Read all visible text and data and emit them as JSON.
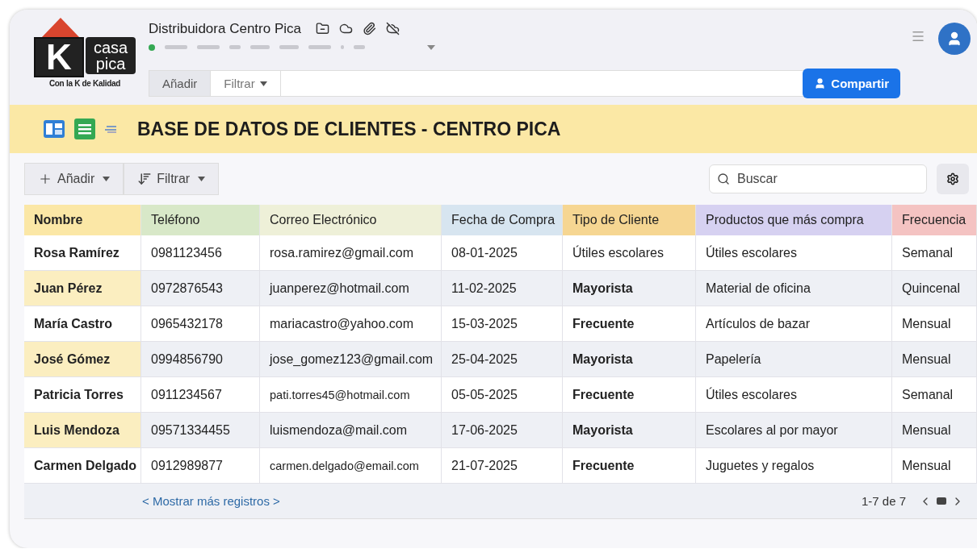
{
  "logo": {
    "letter": "K",
    "line_1": "casa",
    "line_2": "pica",
    "tagline": "Con la K de Kalidad"
  },
  "window": {
    "title": "Distribuidora Centro Pica"
  },
  "tabs": [
    {
      "label": "Añadir",
      "selected": true
    },
    {
      "label": "Filtrar",
      "selected": false,
      "dropdown": true
    }
  ],
  "share_button": "Compartir",
  "banner": {
    "title": "BASE DE DATOS DE CLIENTES - CENTRO PICA"
  },
  "toolbar": {
    "buttons": [
      {
        "label": "Añadir",
        "kind": "add"
      },
      {
        "label": "Filtrar",
        "kind": "sort"
      }
    ],
    "search": {
      "placeholder": "Buscar"
    }
  },
  "table": {
    "columns": [
      {
        "label": "Nombre",
        "color": "#fbe7a6"
      },
      {
        "label": "Teléfono",
        "color": "#d8e8c8"
      },
      {
        "label": "Correo Electrónico",
        "color": "#eef0d8"
      },
      {
        "label": "Fecha de Compra",
        "color": "#d7e5f0"
      },
      {
        "label": "Tipo de Cliente",
        "color": "#f6d692"
      },
      {
        "label": "Productos que más compra",
        "color": "#d6d1f1"
      },
      {
        "label": "Frecuencia",
        "color": "#f4c3c2"
      }
    ],
    "rows": [
      {
        "cells": [
          "Rosa Ramírez",
          "0981123456",
          "rosa.ramirez@gmail.com",
          "08-01-2025",
          "Útiles escolares",
          "Útiles escolares",
          "Semanal"
        ],
        "type_bold": false
      },
      {
        "cells": [
          "Juan Pérez",
          "0972876543",
          "juanperez@hotmail.com",
          "11-02-2025",
          "Mayorista",
          "Material de oficina",
          "Quincenal"
        ],
        "type_bold": true
      },
      {
        "cells": [
          "María Castro",
          "0965432178",
          "mariacastro@yahoo.com",
          "15-03-2025",
          "Frecuente",
          "Artículos de bazar",
          "Mensual"
        ],
        "type_bold": true
      },
      {
        "cells": [
          "José Gómez",
          "0994856790",
          "jose_gomez123@gmail.com",
          "25-04-2025",
          "Mayorista",
          "Papelería",
          "Mensual"
        ],
        "type_bold": true
      },
      {
        "cells": [
          "Patricia Torres",
          "0911234567",
          "pati.torres45@hotmail.com",
          "05-05-2025",
          "Frecuente",
          "Útiles escolares",
          "Semanal"
        ],
        "type_bold": true
      },
      {
        "cells": [
          "Luis Mendoza",
          "09571334455",
          "luismendoza@mail.com",
          "17-06-2025",
          "Mayorista",
          "Escolares al por mayor",
          "Mensual"
        ],
        "type_bold": true
      },
      {
        "cells": [
          "Carmen Delgado",
          "0912989877",
          "carmen.delgado@email.com",
          "21-07-2025",
          "Frecuente",
          "Juguetes y regalos",
          "Mensual"
        ],
        "type_bold": true
      }
    ]
  },
  "footer": {
    "more_link": "< Mostrar más registros >",
    "page_info": "1-7 de 7"
  }
}
